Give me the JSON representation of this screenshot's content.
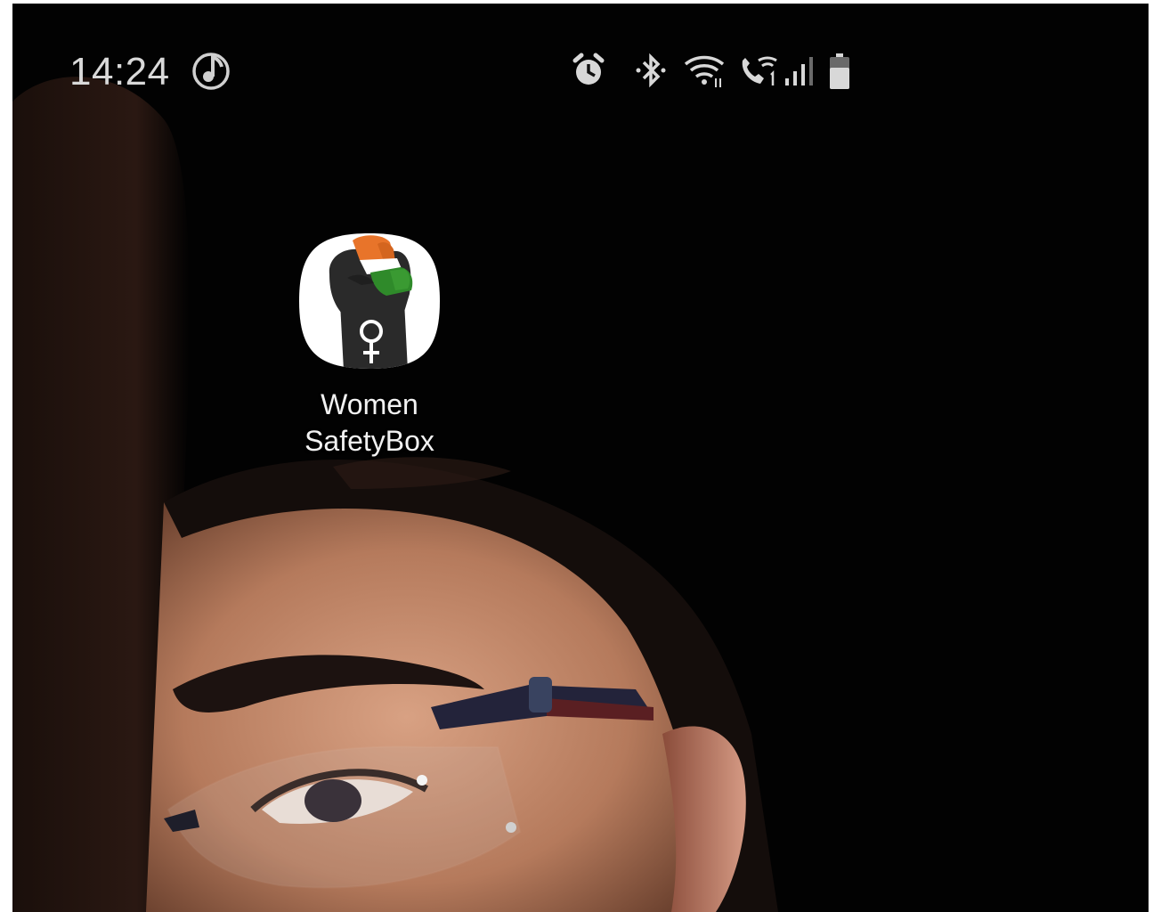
{
  "status_bar": {
    "time": "14:24",
    "icons": [
      "music-note-icon",
      "alarm-icon",
      "bluetooth-icon",
      "wifi-icon",
      "wifi-calling-icon",
      "signal-icon",
      "battery-icon"
    ]
  },
  "home_screen": {
    "app": {
      "name_line1": "Women",
      "name_line2": "SafetyBox",
      "icon": "raised-fist-female-symbol-icon"
    }
  },
  "colors": {
    "background": "#020202",
    "status_text": "#d9d9d9",
    "label_text": "#f2f2f2",
    "saffron": "#e8742a",
    "green": "#2f8a2a",
    "fist": "#2a2a2a"
  }
}
